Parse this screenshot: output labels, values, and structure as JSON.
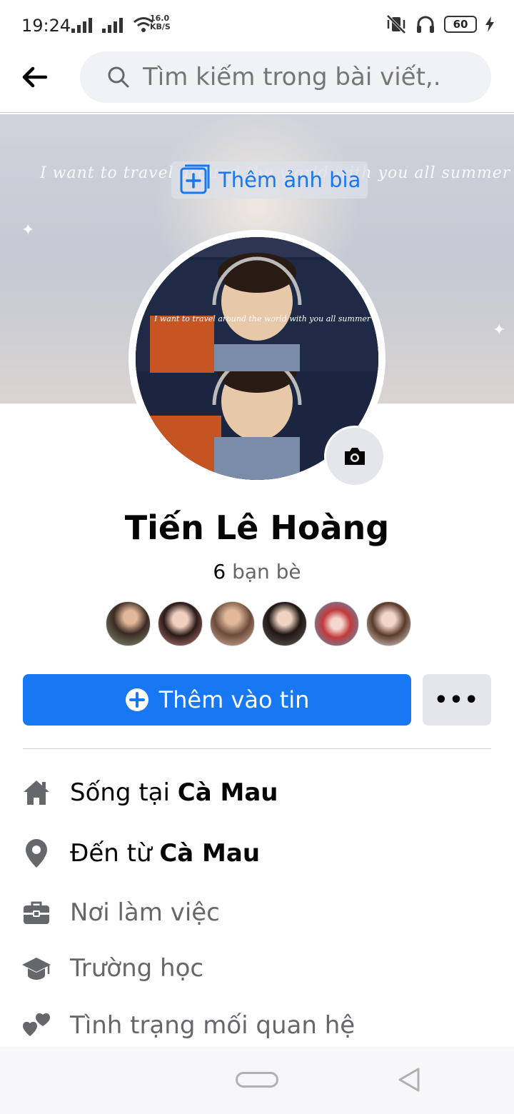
{
  "status_bar": {
    "time": "19:24",
    "net_speed_value": "16.0",
    "net_speed_unit": "KB/S",
    "battery": "60"
  },
  "search": {
    "placeholder": "Tìm kiếm trong bài viết,..."
  },
  "cover": {
    "add_cover_label": "Thêm ảnh bìa",
    "quote": "I want to travel around the world with you all summer"
  },
  "profile": {
    "name": "Tiến Lê Hoàng",
    "friends_count": "6",
    "friends_label": "bạn bè"
  },
  "actions": {
    "add_story_label": "Thêm vào tin",
    "more_label": "•••"
  },
  "details": [
    {
      "icon": "home-icon",
      "prefix": "Sống tại ",
      "value": "Cà Mau"
    },
    {
      "icon": "location-pin-icon",
      "prefix": "Đến từ ",
      "value": "Cà Mau"
    },
    {
      "icon": "briefcase-icon",
      "label": "Nơi làm việc"
    },
    {
      "icon": "graduation-cap-icon",
      "label": "Trường học"
    },
    {
      "icon": "hearts-icon",
      "label": "Tình trạng mối quan hệ"
    }
  ],
  "colors": {
    "accent": "#1877f2",
    "muted_text": "#65676b",
    "icon_gray": "#65676b"
  }
}
